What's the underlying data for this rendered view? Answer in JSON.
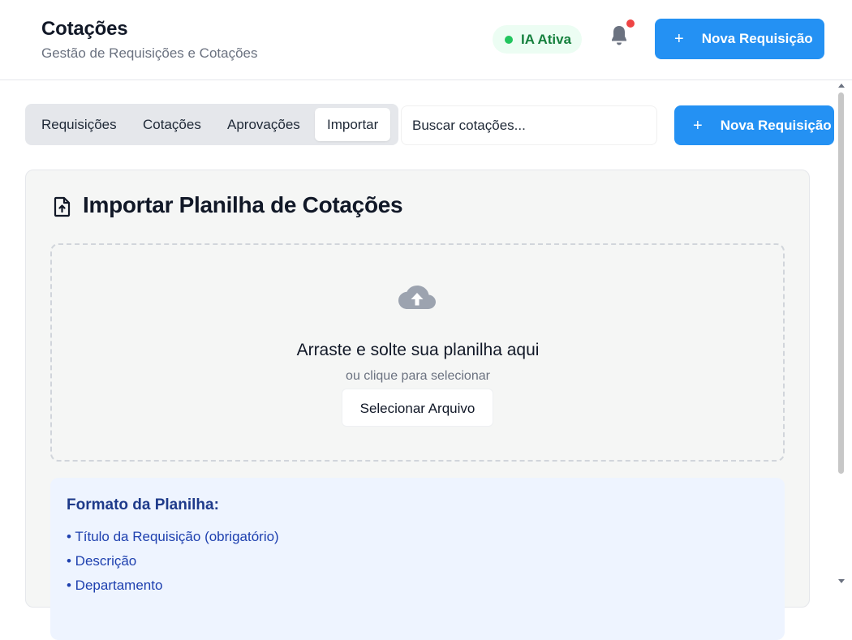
{
  "header": {
    "title": "Cotações",
    "subtitle": "Gestão de Requisições e Cotações",
    "ai_status": "IA Ativa",
    "new_button_label": "Nova Requisição",
    "bell_icon": "bell-icon",
    "colors": {
      "primary": "#2491f3",
      "ai_green": "#22c55e",
      "badge_red": "#ef4444"
    }
  },
  "tabs": [
    {
      "label": "Requisições",
      "active": false
    },
    {
      "label": "Cotações",
      "active": false
    },
    {
      "label": "Aprovações",
      "active": false
    },
    {
      "label": "Importar",
      "active": true
    }
  ],
  "search": {
    "placeholder": "Buscar cotações...",
    "value": ""
  },
  "toolbar": {
    "new_button_label": "Nova Requisição"
  },
  "import_card": {
    "icon": "file-upload-icon",
    "title": "Importar Planilha de Cotações",
    "dropzone": {
      "icon": "cloud-upload-icon",
      "title": "Arraste e solte sua planilha aqui",
      "subtitle": "ou clique para selecionar",
      "button_label": "Selecionar Arquivo"
    },
    "format": {
      "title": "Formato da Planilha:",
      "items": [
        "• Título da Requisição (obrigatório)",
        "• Descrição",
        "• Departamento"
      ]
    }
  }
}
